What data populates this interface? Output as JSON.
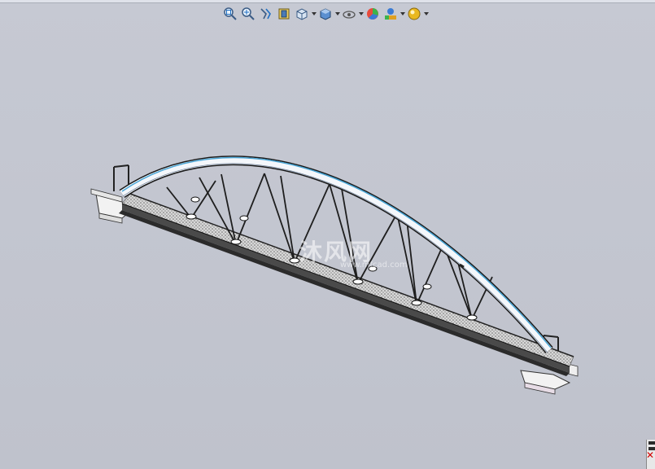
{
  "toolbar": {
    "buttons": [
      {
        "name": "zoom-to-fit",
        "icon": "zoom-to-fit-icon"
      },
      {
        "name": "zoom-to-area",
        "icon": "zoom-area-icon"
      },
      {
        "name": "previous-view",
        "icon": "previous-view-icon"
      },
      {
        "name": "section-view",
        "icon": "section-view-icon"
      },
      {
        "name": "view-orientation",
        "icon": "view-orientation-icon"
      },
      {
        "name": "display-style",
        "icon": "display-style-icon"
      },
      {
        "name": "hide-show-items",
        "icon": "hide-show-icon"
      },
      {
        "name": "edit-appearance",
        "icon": "edit-appearance-icon"
      },
      {
        "name": "apply-scene",
        "icon": "apply-scene-icon"
      },
      {
        "name": "view-settings",
        "icon": "view-settings-icon"
      }
    ]
  },
  "viewport": {
    "model": "arch truss bridge",
    "background_color": "#c4c7d1"
  },
  "watermark": {
    "text": "沐风网",
    "sub": "www.mfcad.com"
  }
}
